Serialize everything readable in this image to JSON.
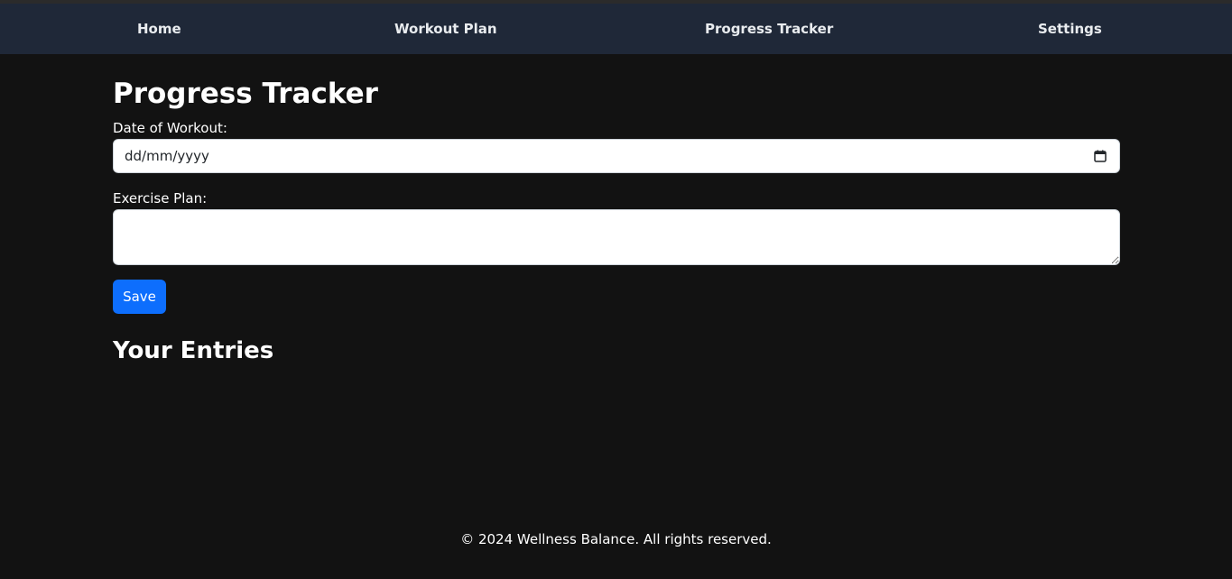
{
  "nav": {
    "items": [
      {
        "label": "Home"
      },
      {
        "label": "Workout Plan"
      },
      {
        "label": "Progress Tracker"
      },
      {
        "label": "Settings"
      }
    ]
  },
  "main": {
    "title": "Progress Tracker",
    "date_field": {
      "label": "Date of Workout:",
      "placeholder": "dd/mm/yyyy",
      "icon": "calendar-icon"
    },
    "plan_field": {
      "label": "Exercise Plan:",
      "value": ""
    },
    "save_label": "Save",
    "entries_heading": "Your Entries",
    "entries": []
  },
  "footer": {
    "text": "© 2024 Wellness Balance. All rights reserved."
  },
  "colors": {
    "background": "#121212",
    "navbar": "#1f2838",
    "accent": "#0d6efd"
  }
}
